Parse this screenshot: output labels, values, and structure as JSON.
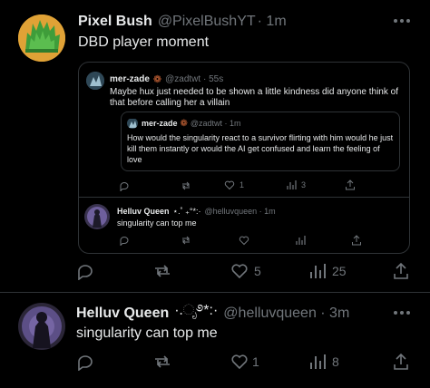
{
  "post1": {
    "author_name": "Pixel Bush",
    "handle": "@PixelBushYT",
    "time": "· 1m",
    "text": "DBD player moment",
    "actions": {
      "likes": "5",
      "views": "25"
    }
  },
  "quote_outer": {
    "author_name": "mer-zade",
    "handle": "@zadtwt · 55s",
    "text": "Maybe hux just needed to be shown a little kindness did anyone think of that before calling her a villain",
    "actions": {
      "likes": "1",
      "views": "3"
    },
    "nested_quote": {
      "author_name": "mer-zade",
      "handle": "@zadtwt · 1m",
      "text": "How would the singularity react to a survivor flirting with him would he just kill them instantly or would the AI get confused and learn the feeling of love"
    },
    "reply": {
      "author_name": "Helluv Queen",
      "decoration": "⋆.˚ ₊°*:·",
      "handle": "@helluvqueen · 1m",
      "text": "singularity can top me"
    }
  },
  "post2": {
    "author_name": "Helluv Queen",
    "decoration": "·.ೃ࿔*:·",
    "handle": "@helluvqueen · 3m",
    "text": "singularity can top me",
    "actions": {
      "likes": "1",
      "views": "8"
    }
  },
  "colors": {
    "background": "#000000",
    "text": "#e7e9ea",
    "muted": "#71767b",
    "border": "#2f3336",
    "pixel_bush_avatar_bg": "#e0a236",
    "pixel_bush_avatar_bush": "#3f9d3a"
  },
  "icons": [
    "more-icon",
    "reply-icon",
    "retweet-icon",
    "like-icon",
    "views-icon",
    "share-icon",
    "verified-badge-icon"
  ]
}
